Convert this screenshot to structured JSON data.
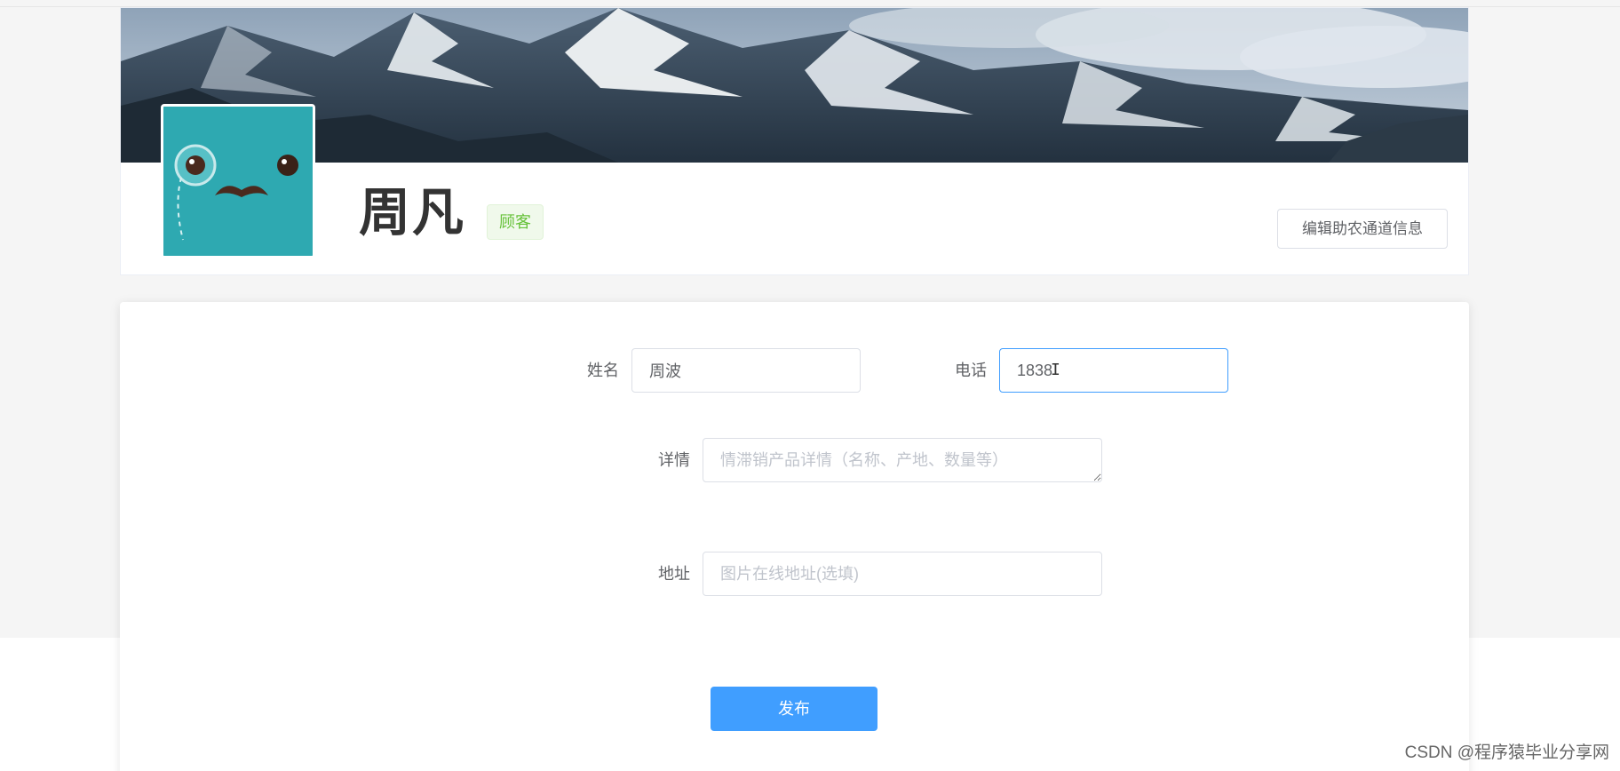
{
  "profile": {
    "name": "周凡",
    "role_tag": "顾客",
    "edit_button_label": "编辑助农通道信息",
    "avatar_icon": "monocle-mustache-face-icon",
    "banner_image": "snowy-mountain-range-banner"
  },
  "form": {
    "name_label": "姓名",
    "name_value": "周波",
    "phone_label": "电话",
    "phone_value": "1838",
    "detail_label": "详情",
    "detail_placeholder": "情滞销产品详情（名称、产地、数量等）",
    "address_label": "地址",
    "address_placeholder": "图片在线地址(选填)",
    "submit_label": "发布"
  },
  "watermark": "CSDN @程序猿毕业分享网",
  "colors": {
    "primary": "#409eff",
    "tag_green": "#67c23a",
    "avatar_teal": "#2ea9b1"
  }
}
